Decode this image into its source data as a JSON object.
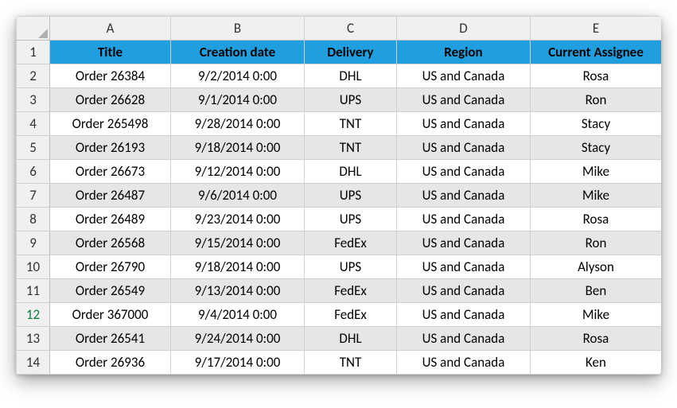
{
  "columns": [
    "A",
    "B",
    "C",
    "D",
    "E"
  ],
  "row_numbers": [
    "1",
    "2",
    "3",
    "4",
    "5",
    "6",
    "7",
    "8",
    "9",
    "10",
    "11",
    "12",
    "13",
    "14"
  ],
  "active_row": "12",
  "headers": {
    "title": "Title",
    "creation_date": "Creation date",
    "delivery": "Delivery",
    "region": "Region",
    "assignee": "Current Assignee"
  },
  "rows": [
    {
      "title": "Order 26384",
      "date": "9/2/2014 0:00",
      "delivery": "DHL",
      "region": "US and Canada",
      "assignee": "Rosa"
    },
    {
      "title": "Order 26628",
      "date": "9/1/2014 0:00",
      "delivery": "UPS",
      "region": "US and Canada",
      "assignee": "Ron"
    },
    {
      "title": "Order 265498",
      "date": "9/28/2014 0:00",
      "delivery": "TNT",
      "region": "US and Canada",
      "assignee": "Stacy"
    },
    {
      "title": "Order 26193",
      "date": "9/18/2014 0:00",
      "delivery": "TNT",
      "region": "US and Canada",
      "assignee": "Stacy"
    },
    {
      "title": "Order 26673",
      "date": "9/12/2014 0:00",
      "delivery": "DHL",
      "region": "US and Canada",
      "assignee": "Mike"
    },
    {
      "title": "Order 26487",
      "date": "9/6/2014 0:00",
      "delivery": "UPS",
      "region": "US and Canada",
      "assignee": "Mike"
    },
    {
      "title": "Order 26489",
      "date": "9/23/2014 0:00",
      "delivery": "UPS",
      "region": "US and Canada",
      "assignee": "Rosa"
    },
    {
      "title": "Order 26568",
      "date": "9/15/2014 0:00",
      "delivery": "FedEx",
      "region": "US and Canada",
      "assignee": "Ron"
    },
    {
      "title": "Order 26790",
      "date": "9/18/2014 0:00",
      "delivery": "UPS",
      "region": "US and Canada",
      "assignee": "Alyson"
    },
    {
      "title": "Order 26549",
      "date": "9/13/2014 0:00",
      "delivery": "FedEx",
      "region": "US and Canada",
      "assignee": "Ben"
    },
    {
      "title": "Order 367000",
      "date": "9/4/2014 0:00",
      "delivery": "FedEx",
      "region": "US and Canada",
      "assignee": "Mike"
    },
    {
      "title": "Order 26541",
      "date": "9/24/2014 0:00",
      "delivery": "DHL",
      "region": "US and Canada",
      "assignee": "Rosa"
    },
    {
      "title": "Order 26936",
      "date": "9/17/2014 0:00",
      "delivery": "TNT",
      "region": "US and Canada",
      "assignee": "Ken"
    }
  ]
}
